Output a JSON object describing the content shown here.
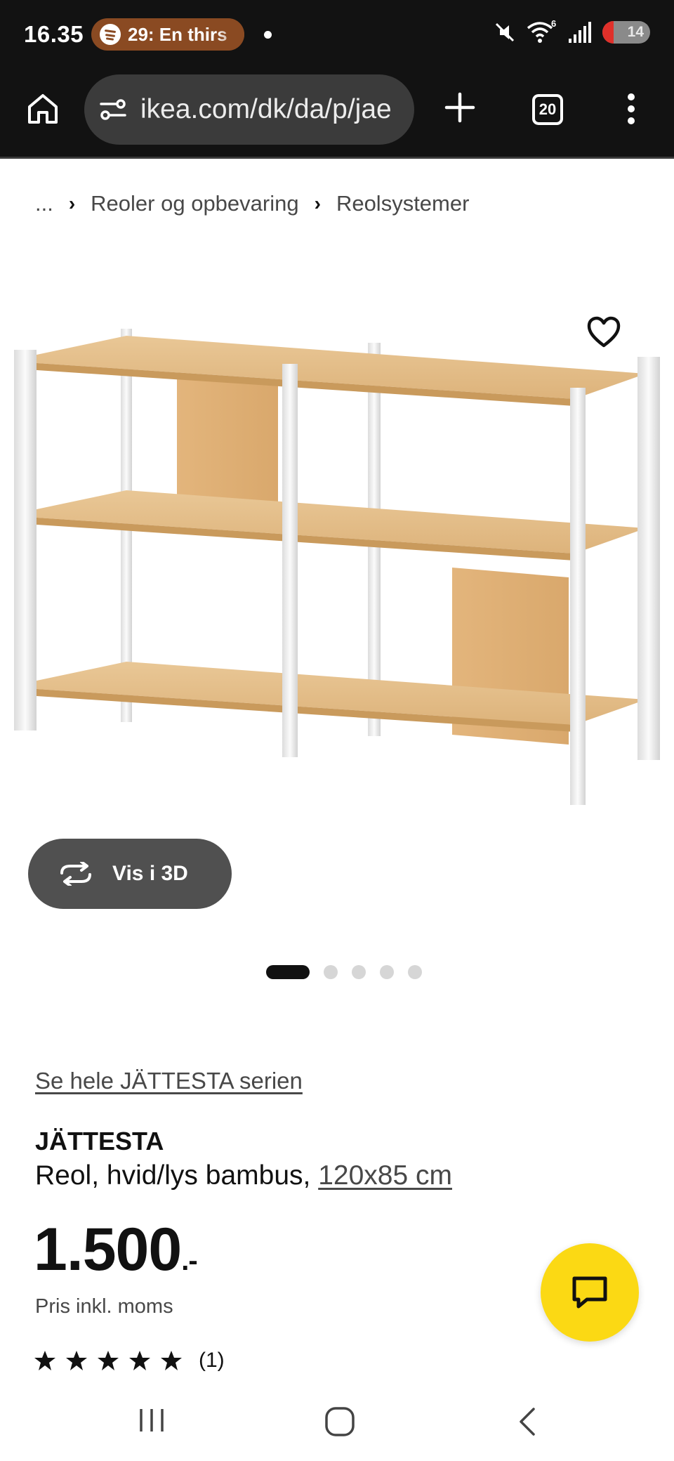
{
  "status_bar": {
    "time": "16.35",
    "media": "29: En thirs",
    "battery": "14"
  },
  "browser": {
    "url": "ikea.com/dk/da/p/jae",
    "tab_count": "20"
  },
  "breadcrumb": {
    "ellipsis": "...",
    "items": [
      "Reoler og opbevaring",
      "Reolsystemer"
    ]
  },
  "gallery": {
    "view_3d_label": "Vis i 3D",
    "image_count": 5,
    "active_index": 0
  },
  "product": {
    "series_link": "Se hele JÄTTESTA serien",
    "name": "JÄTTESTA",
    "description": "Reol, hvid/lys bambus,",
    "size": "120x85 cm",
    "price": "1.500",
    "price_suffix": ".-",
    "price_note": "Pris inkl. moms",
    "rating_stars": 5,
    "rating_count": "(1)"
  },
  "colors": {
    "chat_button": "#fbd914",
    "browser_chrome": "#121212",
    "media_pill": "#8a4a22"
  },
  "icons": [
    "home-icon",
    "site-settings-icon",
    "plus-icon",
    "tabs-icon",
    "more-icon",
    "heart-icon",
    "rotate-3d-icon",
    "star-icon",
    "chat-icon",
    "recents-icon",
    "nav-home-icon",
    "back-icon"
  ]
}
